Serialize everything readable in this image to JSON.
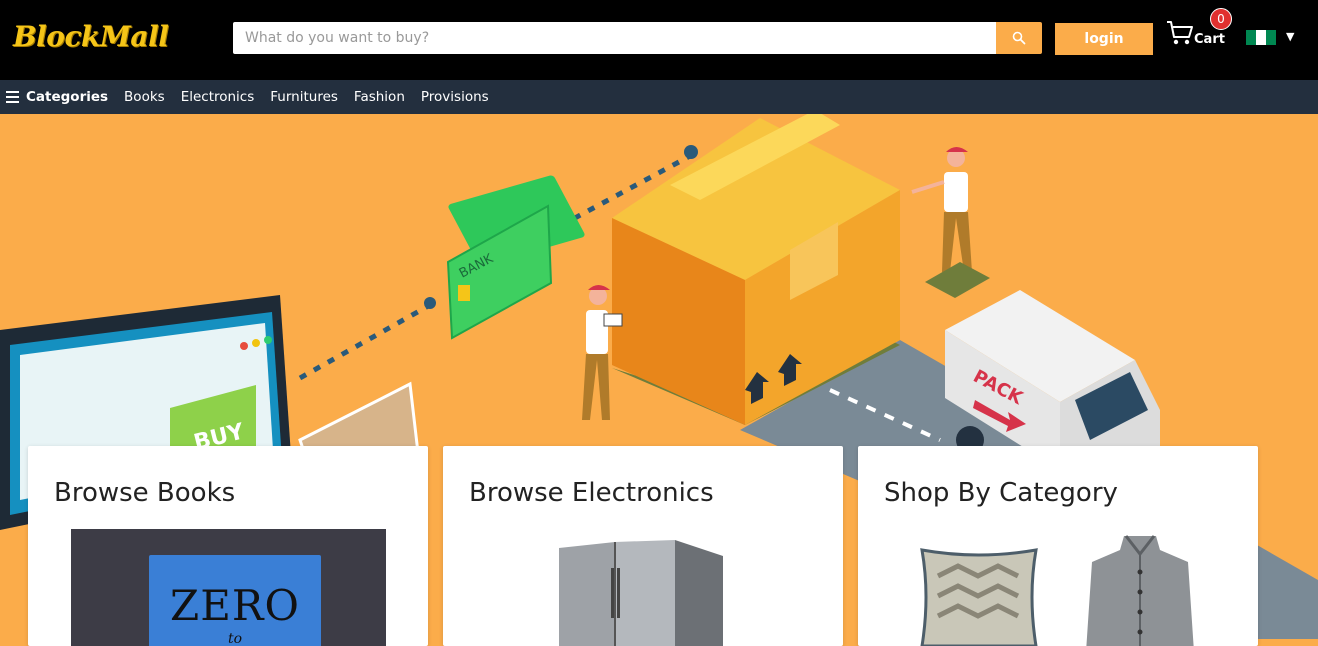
{
  "header": {
    "logo_text": "BlockMall",
    "search_placeholder": "What do you want to buy?",
    "login_label": "login",
    "cart_label": "Cart",
    "cart_count": "0"
  },
  "nav": {
    "categories_label": "Categories",
    "items": [
      "Books",
      "Electronics",
      "Furnitures",
      "Fashion",
      "Provisions"
    ]
  },
  "hero": {
    "bank_card_text": "BANK",
    "buy_text": "BUY",
    "truck_text": "PACK"
  },
  "cards": [
    {
      "title": "Browse Books",
      "book_title": "ZERO",
      "book_subtitle": "to"
    },
    {
      "title": "Browse Electronics"
    },
    {
      "title": "Shop By Category"
    }
  ],
  "colors": {
    "accent": "#fbac4a",
    "topbar": "#000000",
    "navbar": "#232f3e",
    "logo": "#f5c518",
    "badge": "#e0302f"
  }
}
